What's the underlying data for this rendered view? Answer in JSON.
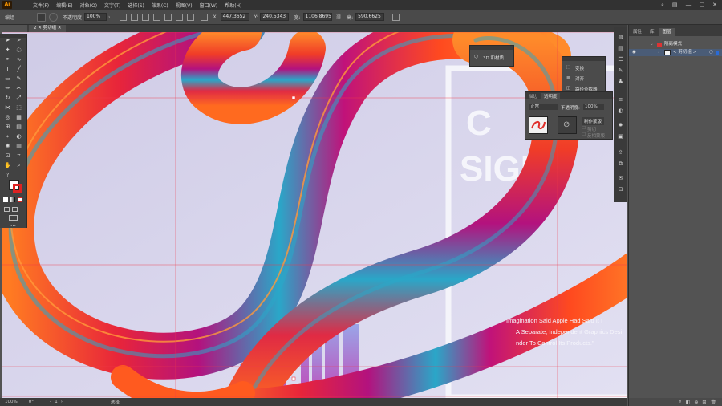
{
  "app": {
    "logo": "Ai"
  },
  "menu": [
    "文件(F)",
    "编辑(E)",
    "对象(O)",
    "文字(T)",
    "选择(S)",
    "效果(C)",
    "视图(V)",
    "窗口(W)",
    "帮助(H)"
  ],
  "menubar_right": {
    "search_icon": "search-icon",
    "workspace_icon": "workspace-icon"
  },
  "control_bar": {
    "group_label": "编组",
    "opacity_label": "不透明度",
    "opacity_value": "100%",
    "x_label": "X:",
    "x_value": "447.3652",
    "y_label": "Y:",
    "y_value": "240.5343",
    "w_label": "宽:",
    "w_value": "1106.8695",
    "h_label": "高:",
    "h_value": "590.6625"
  },
  "document": {
    "tab_label": "2 ✕ 剪切组 ✕"
  },
  "status_bar": {
    "zoom": "100%",
    "angle": "0°",
    "artboard": "1",
    "mode": "选择"
  },
  "artwork": {
    "heading_partial_1": "C",
    "heading_partial_2": "SIGN",
    "quote_lines": [
      "Imagination Said Apple Had Said It I",
      "A Separate, Independent Graphics Desi",
      "nder To Control Its Products.\""
    ],
    "colors": {
      "ribbon_main": "#ff5a1f",
      "ribbon_magenta": "#c0127a",
      "ribbon_teal": "#2aa7c8",
      "bg": "#dcd8ef",
      "guide": "#ef3a4a"
    }
  },
  "panels": {
    "three_d": {
      "label": "3D 和材质"
    },
    "transform": {
      "label_1": "变换",
      "label_2": "对齐",
      "label_3": "路径查找器"
    },
    "transparency": {
      "tab_1": "描边",
      "tab_2": "透明度",
      "blend_mode": "正常",
      "opacity_label": "不透明度:",
      "opacity_value": "100%",
      "make_mask_button": "制作蒙版",
      "clip_label": "剪切",
      "invert_label": "反相蒙版"
    },
    "layers": {
      "tab_1": "属性",
      "tab_2": "库",
      "tab_3": "图层",
      "layer_1": "隔离模式",
      "layer_2": "< 剪切组 >"
    }
  }
}
